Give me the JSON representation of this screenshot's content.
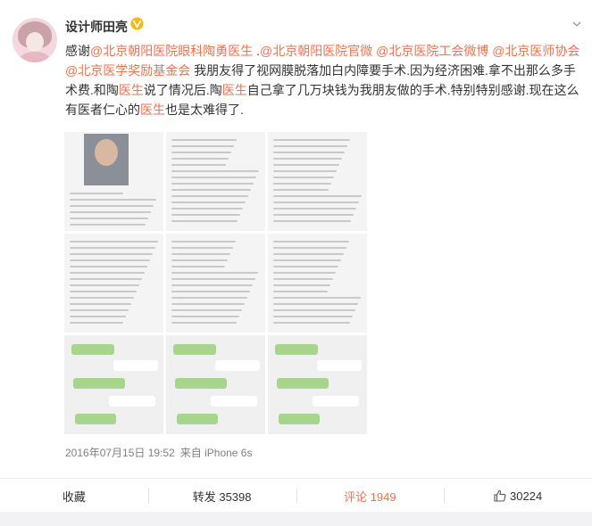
{
  "post": {
    "username": "设计师田亮",
    "segments": [
      {
        "t": "感谢",
        "c": "n"
      },
      {
        "t": "@北京朝阳医院眼科",
        "c": "l"
      },
      {
        "t": "陶勇",
        "c": "h"
      },
      {
        "t": "医生",
        "c": "h"
      },
      {
        "t": " .",
        "c": "n"
      },
      {
        "t": "@北京朝阳医院官微",
        "c": "l"
      },
      {
        "t": " ",
        "c": "n"
      },
      {
        "t": "@北京医院工会微博",
        "c": "l"
      },
      {
        "t": " ",
        "c": "n"
      },
      {
        "t": "@北京医师协会",
        "c": "l"
      },
      {
        "t": " ",
        "c": "n"
      },
      {
        "t": "@北京医学奖励基金会",
        "c": "l"
      },
      {
        "t": " 我朋友得了视网膜脱落加白内障要手术.因为经济困难.拿不出那么多手术费.和陶",
        "c": "n"
      },
      {
        "t": "医生",
        "c": "h"
      },
      {
        "t": "说了情况后.陶",
        "c": "n"
      },
      {
        "t": "医生",
        "c": "h"
      },
      {
        "t": "自己拿了几万块钱为我朋友做的手术.特别特别感谢.现在这么有医者仁心的",
        "c": "n"
      },
      {
        "t": "医生",
        "c": "h"
      },
      {
        "t": "也是太难得了.",
        "c": "n"
      }
    ],
    "timestamp": "2016年07月15日 19:52",
    "source": "来自 iPhone 6s",
    "images": [
      {
        "name": "doctor-profile-image"
      },
      {
        "name": "doctor-bio-image"
      },
      {
        "name": "doctor-research-image"
      },
      {
        "name": "doctor-achievements-image"
      },
      {
        "name": "doctor-honors-image"
      },
      {
        "name": "doctor-awards-image"
      },
      {
        "name": "chat-screenshot-1-image"
      },
      {
        "name": "chat-screenshot-2-image"
      },
      {
        "name": "chat-screenshot-3-image"
      }
    ]
  },
  "actions": {
    "favorite": "收藏",
    "repost": "转发 35398",
    "comment": "评论 1949",
    "like": "30224"
  },
  "colors": {
    "link": "#eb7350",
    "text": "#333333",
    "meta": "#808080",
    "verified": "#f8b60b"
  }
}
